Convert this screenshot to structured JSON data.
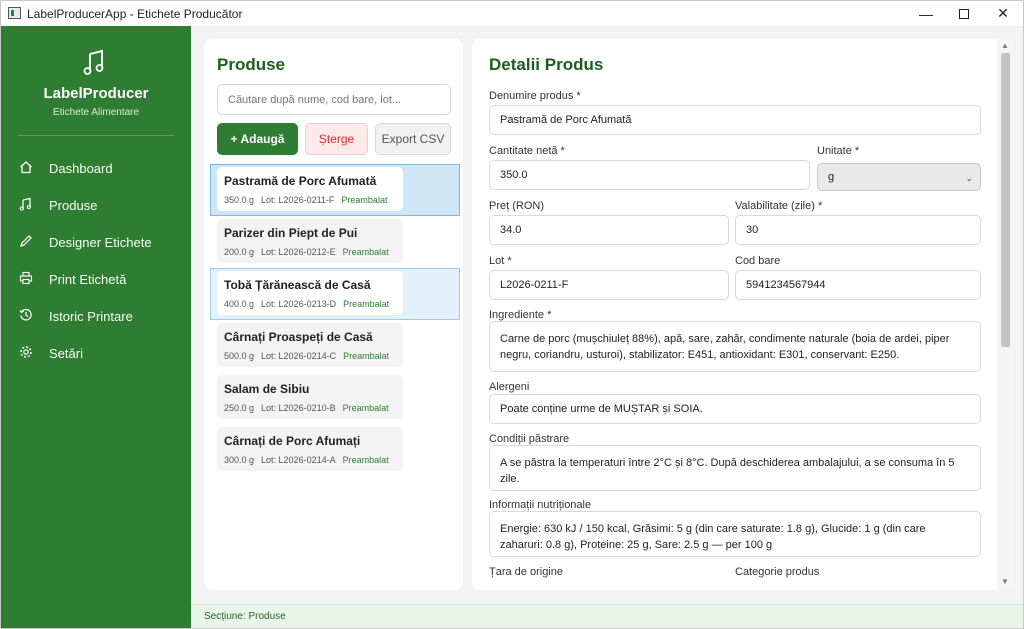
{
  "window": {
    "title": "LabelProducerApp - Etichete Producător",
    "minimize": "—",
    "close": "✕"
  },
  "sidebar": {
    "brand_icon": "music-note-icon",
    "brand_title": "LabelProducer",
    "brand_subtitle": "Etichete Alimentare",
    "items": [
      {
        "label": "Dashboard",
        "icon": "home-icon"
      },
      {
        "label": "Produse",
        "icon": "music-note-icon"
      },
      {
        "label": "Designer Etichete",
        "icon": "pencil-icon"
      },
      {
        "label": "Print Etichetă",
        "icon": "printer-icon"
      },
      {
        "label": "Istoric Printare",
        "icon": "history-icon"
      },
      {
        "label": "Setări",
        "icon": "gear-icon"
      }
    ]
  },
  "products_panel": {
    "title": "Produse",
    "search_placeholder": "Căutare după nume, cod bare, lot...",
    "add_label": "+ Adaugă",
    "delete_label": "Șterge",
    "export_label": "Export CSV",
    "items": [
      {
        "name": "Pastramă de Porc Afumată",
        "qty": "350.0 g",
        "lot": "Lot: L2026-0211-F",
        "tag": "Preambalat",
        "state": "selected"
      },
      {
        "name": "Parizer din Piept de Pui",
        "qty": "200.0 g",
        "lot": "Lot: L2026-0212-E",
        "tag": "Preambalat",
        "state": ""
      },
      {
        "name": "Tobă Țărănească de Casă",
        "qty": "400.0 g",
        "lot": "Lot: L2026-0213-D",
        "tag": "Preambalat",
        "state": "hover"
      },
      {
        "name": "Cârnați Proaspeți de Casă",
        "qty": "500.0 g",
        "lot": "Lot: L2026-0214-C",
        "tag": "Preambalat",
        "state": ""
      },
      {
        "name": "Salam de Sibiu",
        "qty": "250.0 g",
        "lot": "Lot: L2026-0210-B",
        "tag": "Preambalat",
        "state": ""
      },
      {
        "name": "Cârnați de Porc Afumați",
        "qty": "300.0 g",
        "lot": "Lot: L2026-0214-A",
        "tag": "Preambalat",
        "state": ""
      }
    ]
  },
  "details": {
    "title": "Detalii Produs",
    "name_label": "Denumire produs *",
    "name_value": "Pastramă de Porc Afumată",
    "qty_label": "Cantitate netă *",
    "qty_value": "350.0",
    "unit_label": "Unitate *",
    "unit_value": "g",
    "price_label": "Preț (RON)",
    "price_value": "34.0",
    "validity_label": "Valabilitate (zile) *",
    "validity_value": "30",
    "lot_label": "Lot *",
    "lot_value": "L2026-0211-F",
    "barcode_label": "Cod bare",
    "barcode_value": "5941234567944",
    "ingredients_label": "Ingrediente *",
    "ingredients_value": "Carne de porc (mușchiuleț 88%), apă, sare, zahăr, condimente naturale (boia de ardei, piper negru, coriandru, usturoi), stabilizator: E451, antioxidant: E301, conservant: E250.",
    "allergens_label": "Alergeni",
    "allergens_value": "Poate conține urme de MUȘTAR și SOIA.",
    "storage_label": "Condiții păstrare",
    "storage_value": "A se păstra la temperaturi între 2°C și 8°C. După deschiderea ambalajului, a se consuma în 5 zile.",
    "nutrition_label": "Informații nutriționale",
    "nutrition_value": "Energie: 630 kJ / 150 kcal, Grăsimi: 5 g (din care saturate: 1.8 g), Glucide: 1 g (din care zaharuri: 0.8 g), Proteine: 25 g, Sare: 2.5 g — per 100 g",
    "origin_label": "Țara de origine",
    "category_label": "Categorie produs"
  },
  "status": {
    "text": "Secțiune: Produse"
  }
}
